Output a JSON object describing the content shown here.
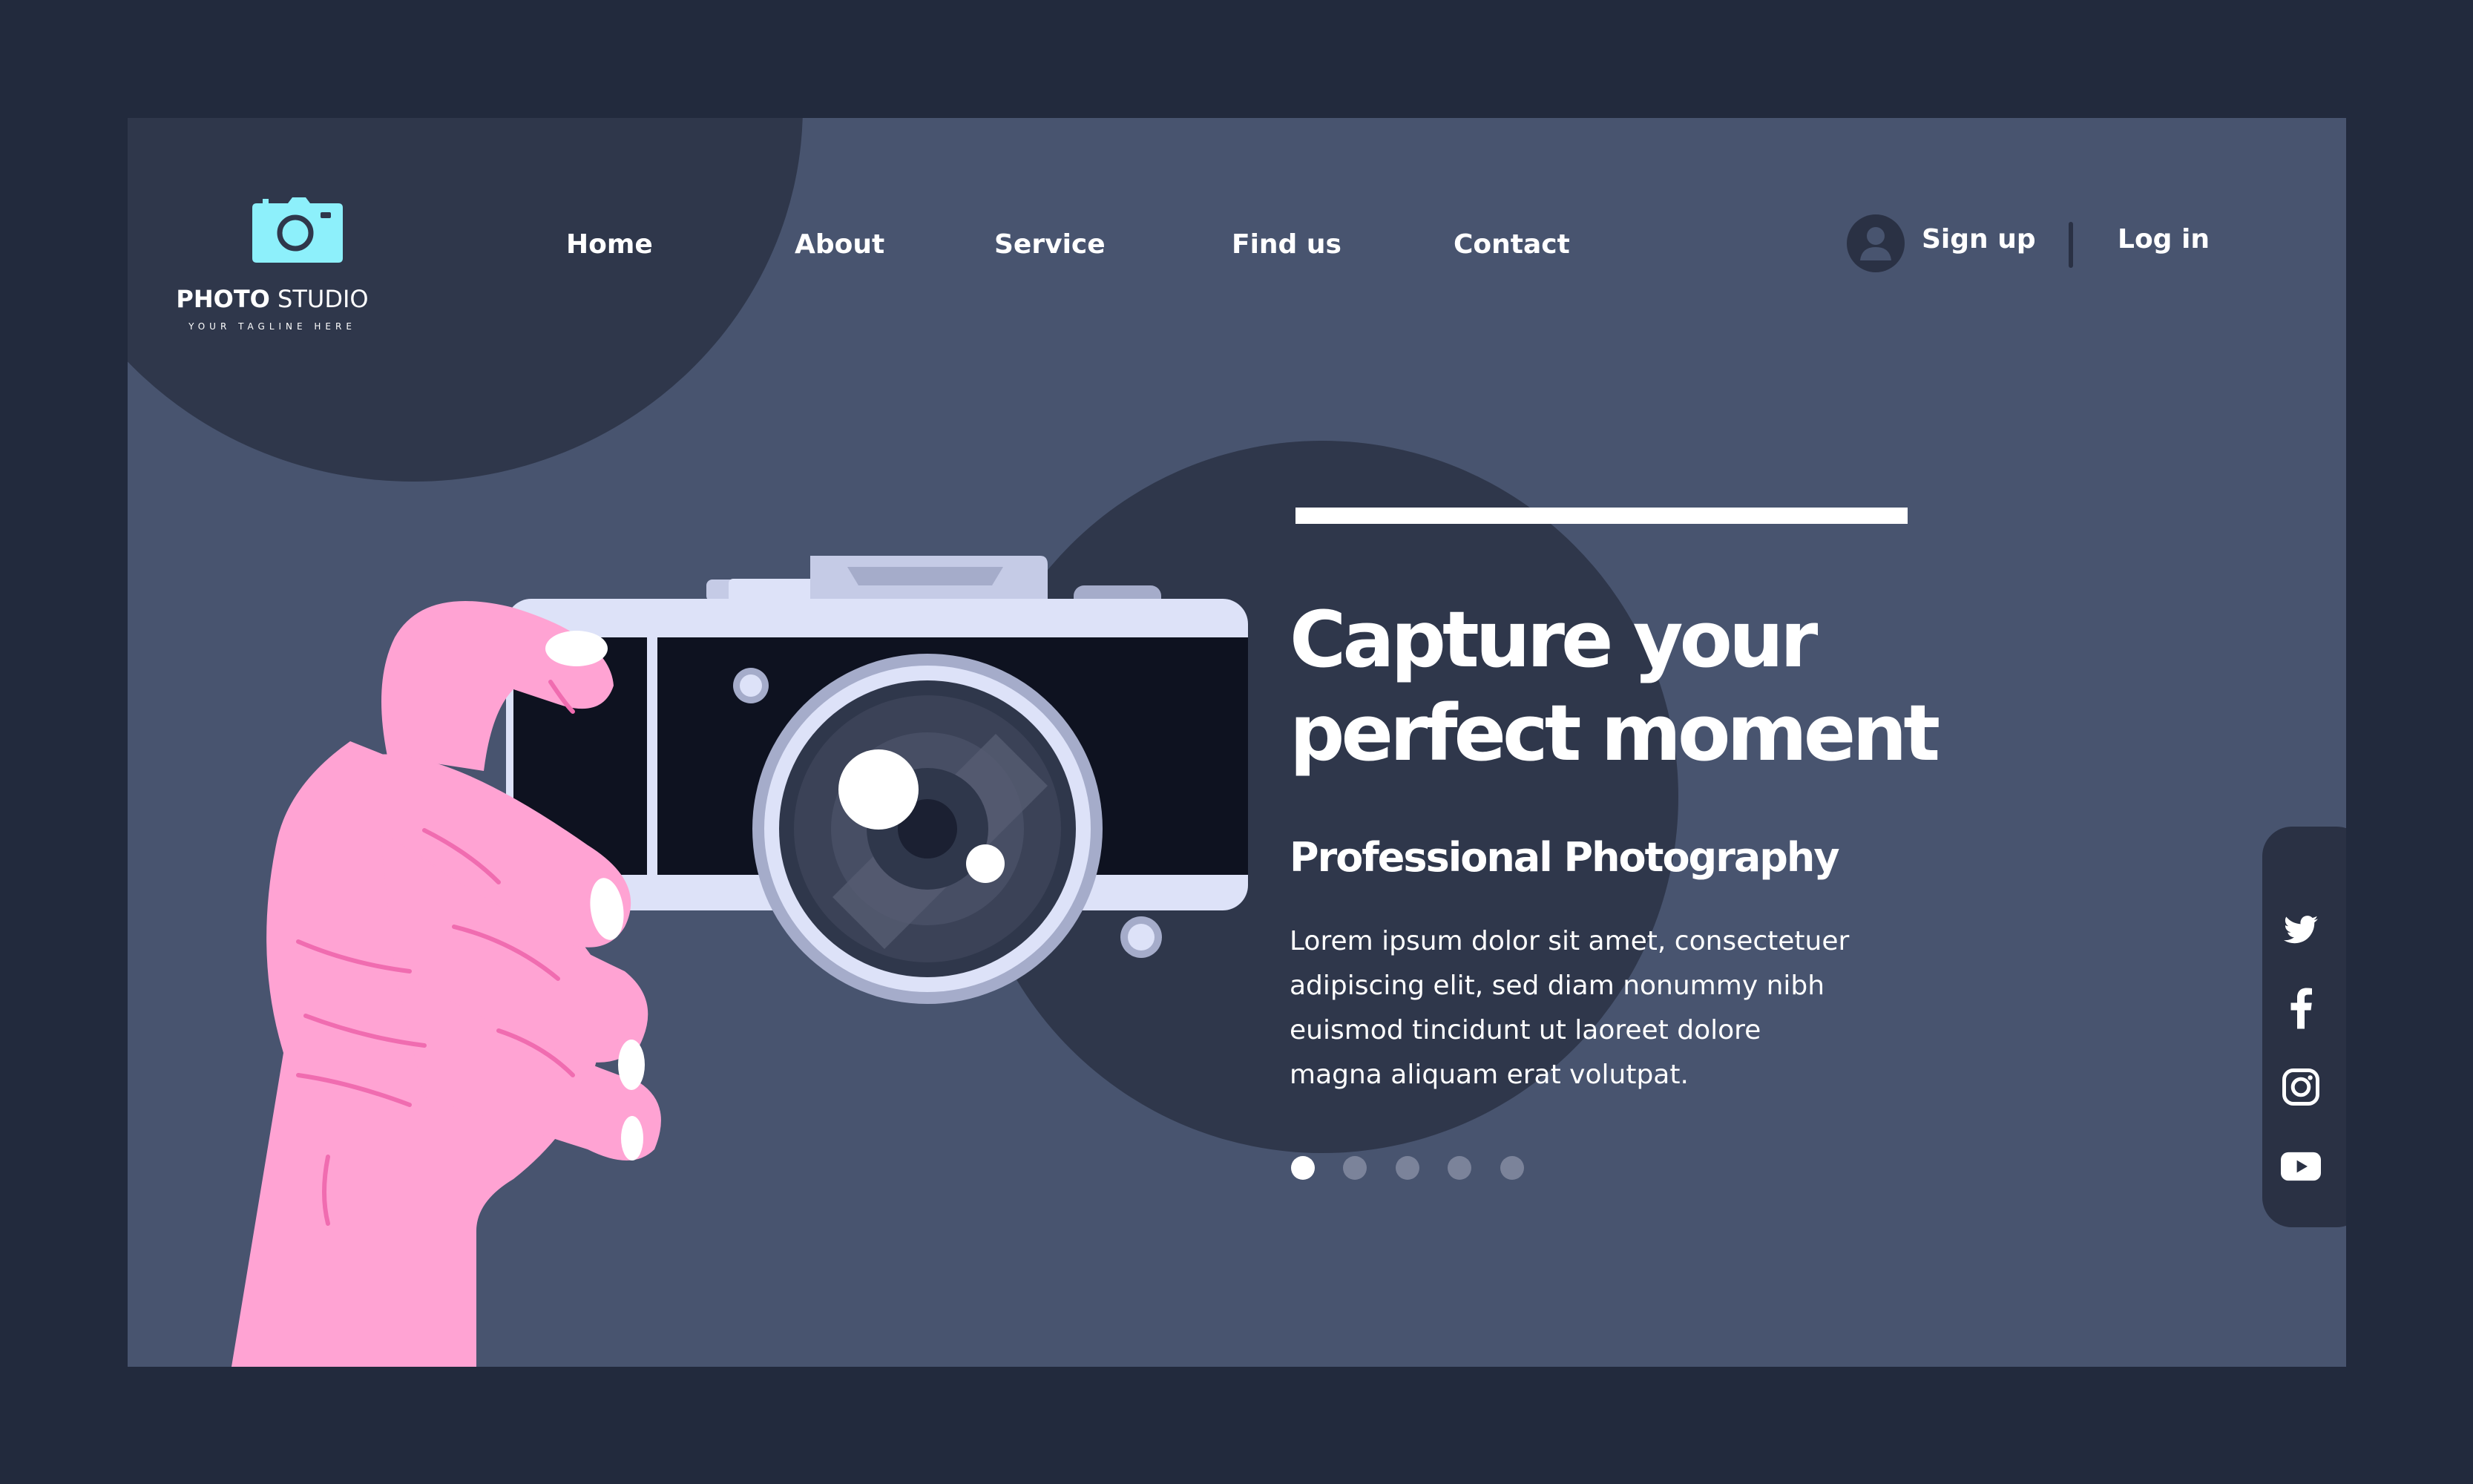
{
  "brand": {
    "name_bold": "PHOTO",
    "name_light": " STUDIO",
    "tagline": "YOUR TAGLINE HERE",
    "icon": "camera-icon",
    "icon_color": "#8df0fb"
  },
  "nav": {
    "items": [
      {
        "label": "Home"
      },
      {
        "label": "About"
      },
      {
        "label": "Service"
      },
      {
        "label": "Find us"
      },
      {
        "label": "Contact"
      }
    ]
  },
  "auth": {
    "avatar_icon": "user-avatar-icon",
    "signup_label": "Sign up",
    "login_label": "Log in"
  },
  "hero": {
    "title_line1": "Capture your",
    "title_line2": "perfect moment",
    "subtitle": "Professional Photography",
    "body": "Lorem ipsum dolor sit amet, consectetuer adipiscing elit, sed diam nonummy nibh euismod tincidunt ut laoreet dolore magna aliquam erat volutpat."
  },
  "carousel": {
    "slide_count": 5,
    "active_index": 0
  },
  "social": [
    {
      "name": "twitter-icon"
    },
    {
      "name": "facebook-icon"
    },
    {
      "name": "instagram-icon"
    },
    {
      "name": "youtube-icon"
    }
  ],
  "colors": {
    "page_background": "#222a3d",
    "panel_background": "#48546f",
    "dark_shape": "#2f374b",
    "hand": "#ffa3d3",
    "accent_cyan": "#8df0fb",
    "text": "#ffffff"
  }
}
